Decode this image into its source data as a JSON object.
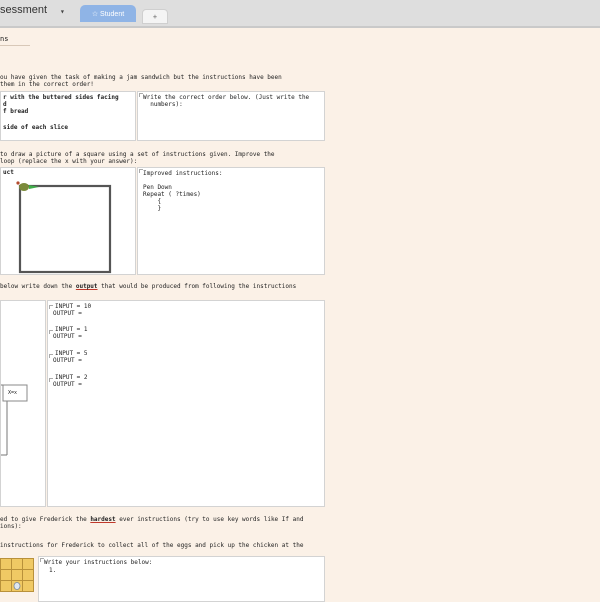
{
  "window": {
    "title": "sessment",
    "caret": "▾",
    "tabs": [
      {
        "label": "☆ Student"
      },
      {
        "label": "+"
      }
    ]
  },
  "page": {
    "heading": "ns"
  },
  "q1": {
    "prompt_line1": "ou have given the task of making a jam sandwich but the instructions have been",
    "prompt_line2": "them in the correct order!",
    "steps": [
      "r with the buttered sides facing",
      "d",
      "f bread",
      "",
      "",
      "side of each slice"
    ],
    "answer_placeholder": "Write the correct order below. (Just write the\n  numbers):"
  },
  "q2": {
    "prompt_line1": "to draw a picture of a square using a set of instructions given. Improve the",
    "prompt_line2": "loop (replace the x with your answer):",
    "left_label": "uct",
    "right_label": "Improved instructions:",
    "code": [
      "Pen Down",
      "Repeat ( ?times)",
      "    {",
      "    }"
    ]
  },
  "q3": {
    "prompt_start": "below write down the ",
    "prompt_keyword": "output",
    "prompt_end": " that would be produced from following the instructions",
    "flow_label": "X=x",
    "io": [
      {
        "input": "INPUT = 10",
        "output": "OUTPUT ="
      },
      {
        "input": "INPUT = 1",
        "output": "OUTPUT ="
      },
      {
        "input": "INPUT = 5",
        "output": "OUTPUT ="
      },
      {
        "input": "INPUT = 2",
        "output": "OUTPUT ="
      }
    ]
  },
  "q4": {
    "line1_start": "ed to give Frederick the ",
    "line1_keyword": "hardest",
    "line1_end": " ever instructions (try to use key words like If and",
    "line2": "ions):"
  },
  "q5": {
    "prompt": "instructions for Frederick to collect all of the eggs and pick up the chicken at the",
    "answer_placeholder": "Write your instructions below:",
    "answer_start": "1."
  }
}
